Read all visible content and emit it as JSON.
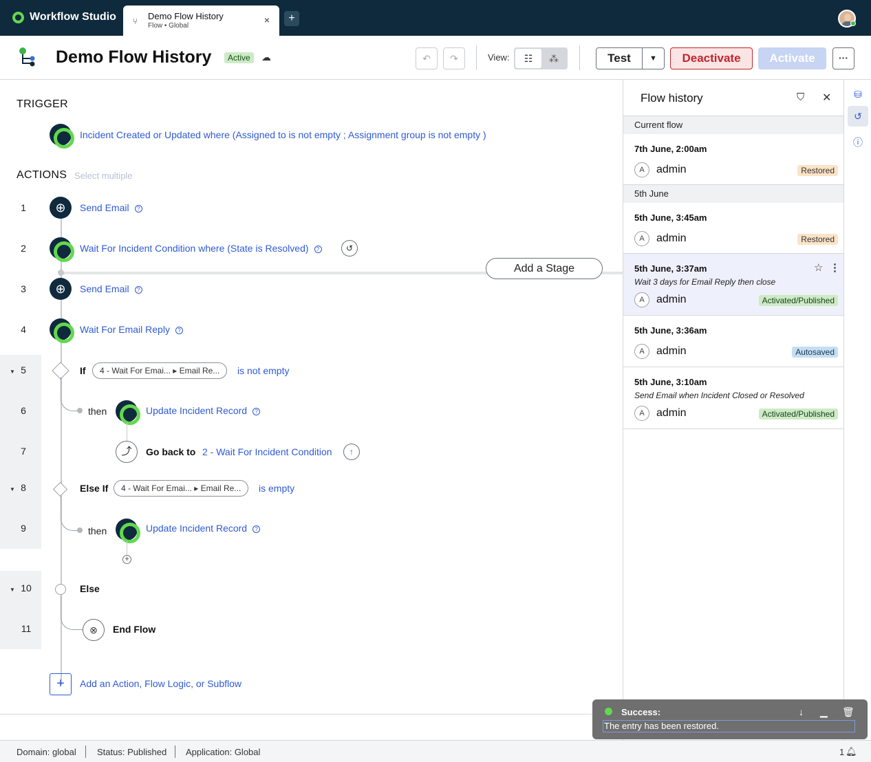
{
  "topbar": {
    "brand": "Workflow Studio",
    "tab_title": "Demo Flow History",
    "tab_subtitle": "Flow • Global",
    "close_glyph": "×",
    "new_tab_glyph": "+"
  },
  "header": {
    "title": "Demo Flow History",
    "status": "Active",
    "view_label": "View:",
    "test_label": "Test",
    "deactivate_label": "Deactivate",
    "activate_label": "Activate",
    "more_glyph": "···"
  },
  "flow": {
    "trigger_heading": "TRIGGER",
    "trigger_text": "Incident Created or Updated where (Assigned to is not empty ; Assignment group is not empty )",
    "actions_heading": "ACTIONS",
    "select_multiple": "Select multiple",
    "add_stage": "Add a Stage",
    "steps": [
      {
        "num": "1",
        "text": "Send Email"
      },
      {
        "num": "2",
        "text": "Wait For Incident Condition where (State is Resolved)"
      },
      {
        "num": "3",
        "text": "Send Email"
      },
      {
        "num": "4",
        "text": "Wait For Email Reply"
      },
      {
        "num": "5",
        "keyword": "If",
        "pill_a": "4 - Wait For Emai...",
        "pill_b": "Email Re...",
        "condition": "is not empty"
      },
      {
        "num": "6",
        "then": "then",
        "text": "Update Incident Record"
      },
      {
        "num": "7",
        "keyword": "Go back to",
        "text": "2 - Wait For Incident Condition"
      },
      {
        "num": "8",
        "keyword": "Else If",
        "pill_a": "4 - Wait For Emai...",
        "pill_b": "Email Re...",
        "condition": "is empty"
      },
      {
        "num": "9",
        "then": "then",
        "text": "Update Incident Record"
      },
      {
        "num": "10",
        "keyword": "Else"
      },
      {
        "num": "11",
        "keyword": "End Flow"
      }
    ],
    "add_action": "Add an Action, Flow Logic, or Subflow"
  },
  "history": {
    "title": "Flow history",
    "groups": [
      {
        "label": "Current flow"
      },
      {
        "label": "5th June"
      }
    ],
    "entries": [
      {
        "time": "7th June, 2:00am",
        "note": "",
        "user_initial": "A",
        "user": "admin",
        "tag": "Restored"
      },
      {
        "time": "5th June, 3:45am",
        "note": "",
        "user_initial": "A",
        "user": "admin",
        "tag": "Restored"
      },
      {
        "time": "5th June, 3:37am",
        "note": "Wait 3 days for Email Reply then close",
        "user_initial": "A",
        "user": "admin",
        "tag": "Activated/Published"
      },
      {
        "time": "5th June, 3:36am",
        "note": "",
        "user_initial": "A",
        "user": "admin",
        "tag": "Autosaved"
      },
      {
        "time": "5th June, 3:10am",
        "note": "Send Email when Incident Closed or Resolved",
        "user_initial": "A",
        "user": "admin",
        "tag": "Activated/Published"
      }
    ]
  },
  "statusbar": {
    "domain": "Domain: global",
    "status": "Status: Published",
    "application": "Application: Global",
    "notifications": "1"
  },
  "toast": {
    "title": "Success:",
    "message": "The entry has been restored."
  },
  "colors": {
    "topbar": "#0f2a3c",
    "accent_green": "#62d84e",
    "link_blue": "#2f5bd3",
    "danger": "#c0262d"
  }
}
